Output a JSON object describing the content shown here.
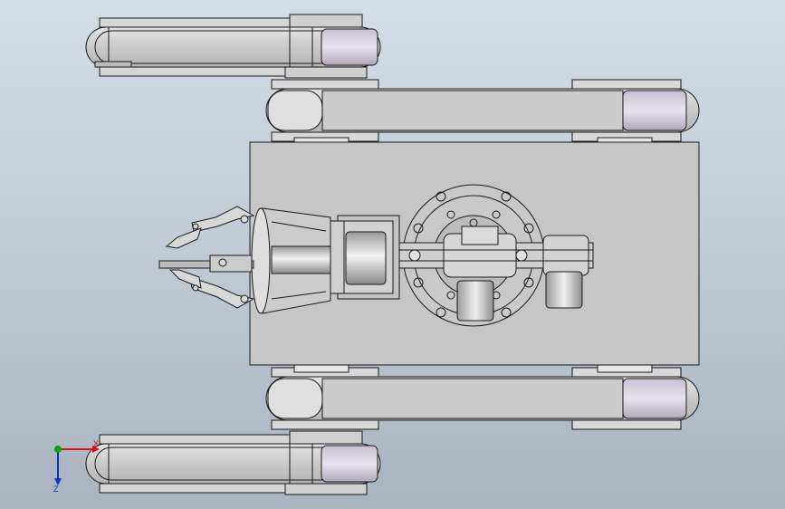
{
  "viewport": {
    "type": "CAD 3D model view (top view of tracked robot with gripper arm)"
  },
  "triad": {
    "x_label": "X",
    "z_label": "Z"
  },
  "colors": {
    "background_top": "#d4dce6",
    "background_bottom": "#a9b4c1",
    "part_fill": "#c8c8c8",
    "track_fill": "#d2d2d2",
    "edge": "#1a1a1a",
    "x_axis": "#e01010",
    "y_axis": "#10a010",
    "z_axis": "#1030c0"
  },
  "icons": {
    "triad": "coordinate-triad-icon"
  }
}
